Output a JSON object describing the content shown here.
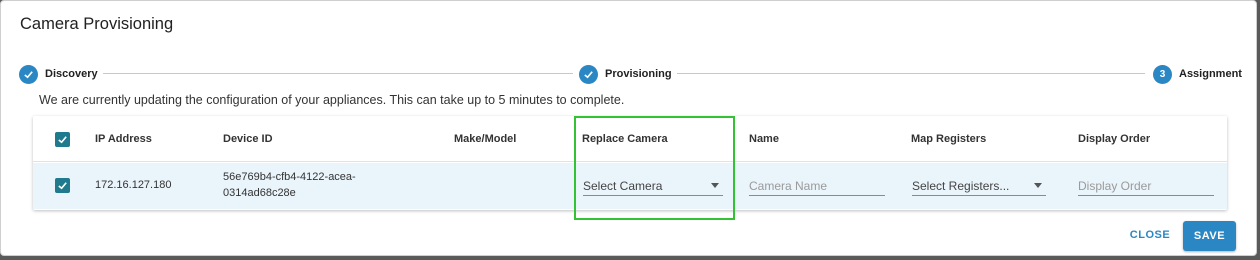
{
  "dialog": {
    "title": "Camera Provisioning",
    "info_text": "We are currently updating the configuration of your appliances. This can take up to 5 minutes to complete."
  },
  "stepper": {
    "steps": [
      {
        "label": "Discovery",
        "state": "complete"
      },
      {
        "label": "Provisioning",
        "state": "complete"
      },
      {
        "label": "Assignment",
        "number": "3",
        "state": "active"
      }
    ]
  },
  "table": {
    "headers": {
      "ip": "IP Address",
      "device_id": "Device ID",
      "make_model": "Make/Model",
      "replace_camera": "Replace Camera",
      "name": "Name",
      "map_registers": "Map Registers",
      "display_order": "Display Order"
    },
    "rows": [
      {
        "checked": true,
        "ip": "172.16.127.180",
        "device_id_line1": "56e769b4-cfb4-4122-acea-",
        "device_id_line2": "0314ad68c28e",
        "make_model": "",
        "replace_camera_value": "Select Camera",
        "name_placeholder": "Camera Name",
        "map_registers_value": "Select Registers...",
        "display_order_placeholder": "Display Order"
      }
    ]
  },
  "actions": {
    "close_label": "CLOSE",
    "save_label": "SAVE"
  },
  "colors": {
    "accent": "#2a87c4",
    "checkbox": "#1e7a8c",
    "row_highlight": "#eaf4fb",
    "annotation_box": "#33c233"
  }
}
